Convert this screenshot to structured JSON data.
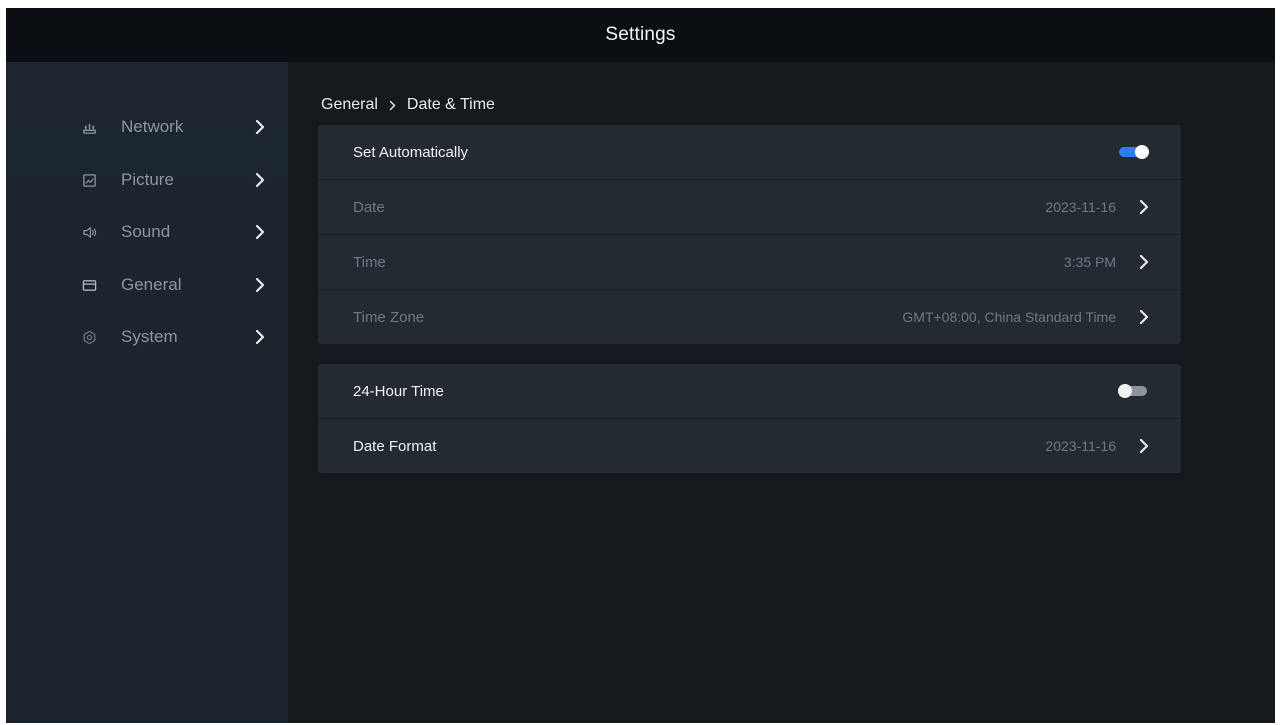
{
  "header": {
    "title": "Settings"
  },
  "sidebar": {
    "items": [
      {
        "label": "Network",
        "icon": "network-icon"
      },
      {
        "label": "Picture",
        "icon": "picture-icon"
      },
      {
        "label": "Sound",
        "icon": "sound-icon"
      },
      {
        "label": "General",
        "icon": "general-icon"
      },
      {
        "label": "System",
        "icon": "system-icon"
      }
    ]
  },
  "breadcrumb": {
    "parent": "General",
    "current": "Date & Time"
  },
  "group1": {
    "set_automatically": {
      "label": "Set Automatically",
      "enabled": true
    },
    "date": {
      "label": "Date",
      "value": "2023-11-16"
    },
    "time": {
      "label": "Time",
      "value": "3:35 PM"
    },
    "time_zone": {
      "label": "Time Zone",
      "value": "GMT+08:00, China Standard Time"
    }
  },
  "group2": {
    "hour24": {
      "label": "24-Hour Time",
      "enabled": false
    },
    "date_format": {
      "label": "Date Format",
      "value": "2023-11-16"
    }
  },
  "colors": {
    "accent": "#2f7df6",
    "background": "#15191e",
    "sidebar": "#1d2630",
    "card": "#232a32"
  }
}
